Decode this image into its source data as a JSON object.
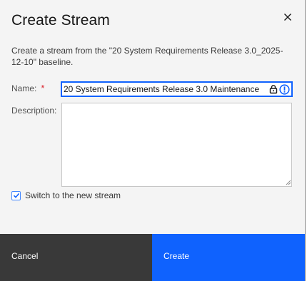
{
  "dialog": {
    "title": "Create Stream",
    "description": "Create a stream from the \"20 System Requirements Release 3.0_2025-12-10\" baseline.",
    "close_icon": "close-icon"
  },
  "form": {
    "name_label": "Name:",
    "required_marker": "*",
    "name_value": "20 System Requirements Release 3.0 Maintenance",
    "description_label": "Description:",
    "description_value": "",
    "field_icons": [
      "lock-icon",
      "info-icon"
    ]
  },
  "options": {
    "switch_label": "Switch to the new stream",
    "switch_checked": true
  },
  "footer": {
    "cancel_label": "Cancel",
    "create_label": "Create"
  },
  "colors": {
    "primary": "#0f62fe",
    "secondary": "#393939",
    "required": "#da1e28",
    "background": "#f4f4f4"
  }
}
